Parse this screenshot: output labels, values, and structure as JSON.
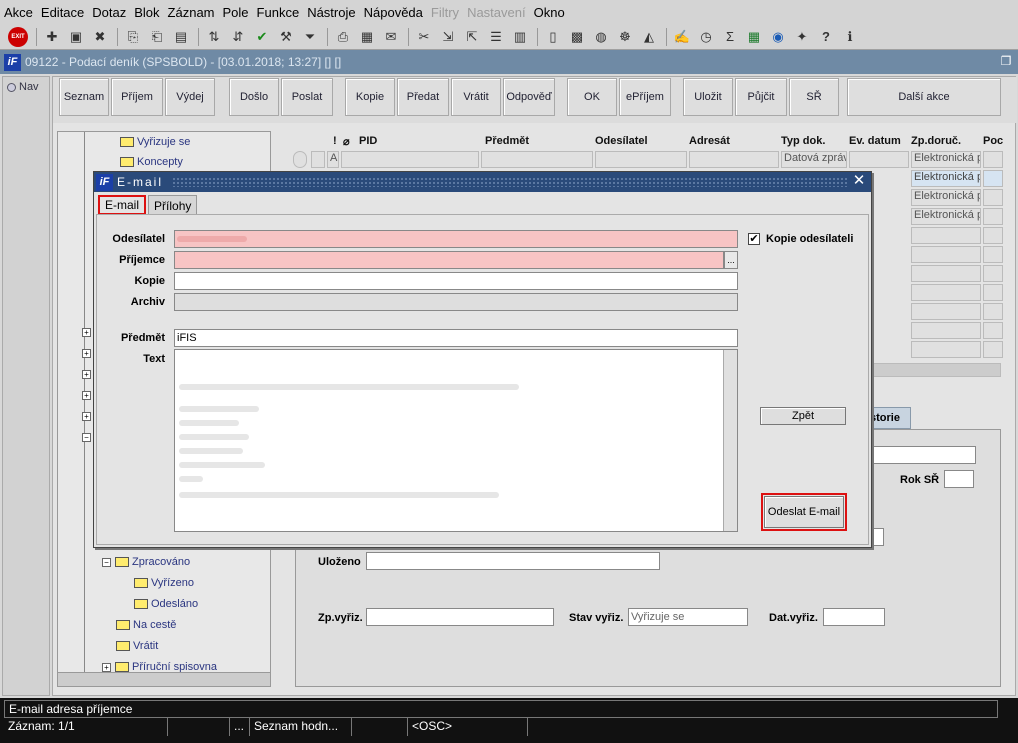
{
  "menu": [
    "Akce",
    "Editace",
    "Dotaz",
    "Blok",
    "Záznam",
    "Pole",
    "Funkce",
    "Nástroje",
    "Nápověda",
    "Filtry",
    "Nastavení",
    "Okno"
  ],
  "menu_disabled": [
    "Filtry",
    "Nastavení"
  ],
  "window": {
    "title": "09122 - Podací deník (SPSBOLD) - [03.01.2018; 13:27]  [] []"
  },
  "nav": {
    "label": "Nav"
  },
  "buttons": [
    "Seznam",
    "Příjem",
    "Výdej",
    "Došlo",
    "Poslat",
    "Kopie",
    "Předat",
    "Vrátit",
    "Odpověď",
    "OK",
    "ePříjem",
    "Uložit",
    "Půjčit",
    "SŘ",
    "Další akce"
  ],
  "tree": {
    "items": [
      "Vyřizuje se",
      "Koncepty",
      "Zpracováno",
      "Vyřízeno",
      "Odesláno",
      "Na cestě",
      "Vrátit",
      "Příruční spisovna"
    ]
  },
  "grid": {
    "headers": [
      "!",
      "PID",
      "Předmět",
      "Odesílatel",
      "Adresát",
      "Typ dok.",
      "Ev. datum",
      "Zp.doruč.",
      "Poc"
    ],
    "row1": {
      "flag": "A",
      "typ": "Datová zpráv"
    },
    "zp_values": [
      "Elektronická p",
      "Elektronická p",
      "Elektronická p",
      "Elektronická p"
    ]
  },
  "lower": {
    "tab_label": "storie",
    "rok_label": "Rok SŘ",
    "ulozeno_label": "Uloženo",
    "zpvyriz_label": "Zp.vyřiz.",
    "stav_label": "Stav vyřiz.",
    "stav_value": "Vyřizuje se",
    "datvyriz_label": "Dat.vyřiz."
  },
  "dialog": {
    "title": "E-mail",
    "tabs": [
      "E-mail",
      "Přílohy"
    ],
    "labels": {
      "odesilatel": "Odesílatel",
      "prijemce": "Příjemce",
      "kopie": "Kopie",
      "archiv": "Archiv",
      "predmet": "Předmět",
      "text": "Text"
    },
    "predmet_value": "iFIS",
    "kopie_odesilateli_label": "Kopie odesílateli",
    "kopie_odesilateli_checked": true,
    "browse_label": "...",
    "zpet_label": "Zpět",
    "send_label": "Odeslat E-mail"
  },
  "status": {
    "message": "E-mail adresa příjemce",
    "record": "Záznam: 1/1",
    "dots": "...",
    "list": "Seznam hodn...",
    "osc": "<OSC>"
  }
}
